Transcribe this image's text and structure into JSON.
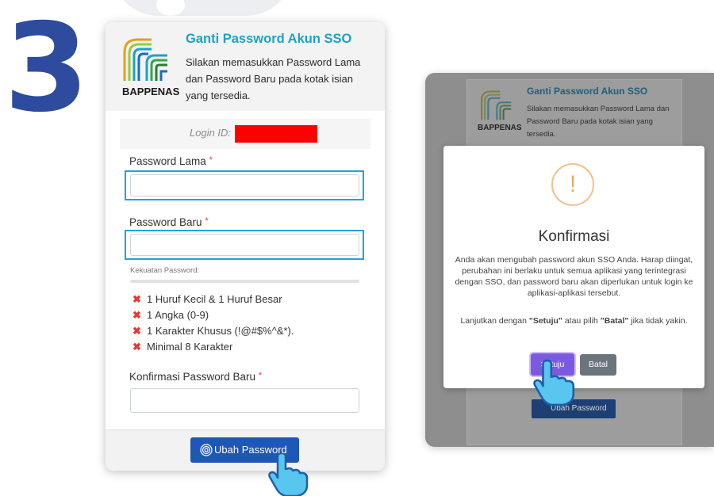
{
  "step": "3",
  "left_form": {
    "logo_text": "BAPPENAS",
    "title": "Ganti Password Akun SSO",
    "description": "Silakan memasukkan Password Lama dan Password Baru pada kotak isian yang tersedia.",
    "login_id_label": "Login ID:",
    "password_lama_label": "Password Lama",
    "password_baru_label": "Password Baru",
    "required_mark": "*",
    "strength_label": "Kekuatan Password:",
    "requirements": [
      "1 Huruf Kecil & 1 Huruf Besar",
      "1 Angka (0-9)",
      "1 Karakter Khusus (!@#$%^&*).",
      "Minimal 8 Karakter"
    ],
    "konfirmasi_label": "Konfirmasi Password Baru",
    "submit_label": "Ubah Password"
  },
  "right_dialog": {
    "bg_logo_text": "BAPPENAS",
    "bg_title": "Ganti Password Akun SSO",
    "bg_description": "Silakan memasukkan Password Lama dan Password Baru pada kotak isian yang tersedia.",
    "bg_button": "Ubah Password",
    "warning_glyph": "!",
    "modal_title": "Konfirmasi",
    "modal_message": "Anda akan mengubah password akun SSO Anda. Harap diingat, perubahan ini berlaku untuk semua aplikasi yang terintegrasi dengan SSO, dan password baru akan diperlukan untuk login ke aplikasi-aplikasi tersebut.",
    "modal_prompt_prefix": "Lanjutkan dengan ",
    "modal_prompt_setuju": "\"Setuju\"",
    "modal_prompt_middle": " atau pilih ",
    "modal_prompt_batal": "\"Batal\"",
    "modal_prompt_suffix": " jika tidak yakin.",
    "setuju_label": "Setuju",
    "batal_label": "Batal"
  },
  "colors": {
    "step_number": "#2e4b9d",
    "title": "#1aa3c9",
    "highlight": "#1fa3dc",
    "primary_button": "#1e57b5",
    "setuju_button": "#7c5ae0",
    "batal_button": "#6c757d",
    "error_x": "#e53935",
    "redaction": "#ff0000"
  },
  "icons": [
    "bappenas-logo-icon",
    "x-mark-icon",
    "fingerprint-icon",
    "warning-icon",
    "pointing-hand-cursor-icon"
  ]
}
